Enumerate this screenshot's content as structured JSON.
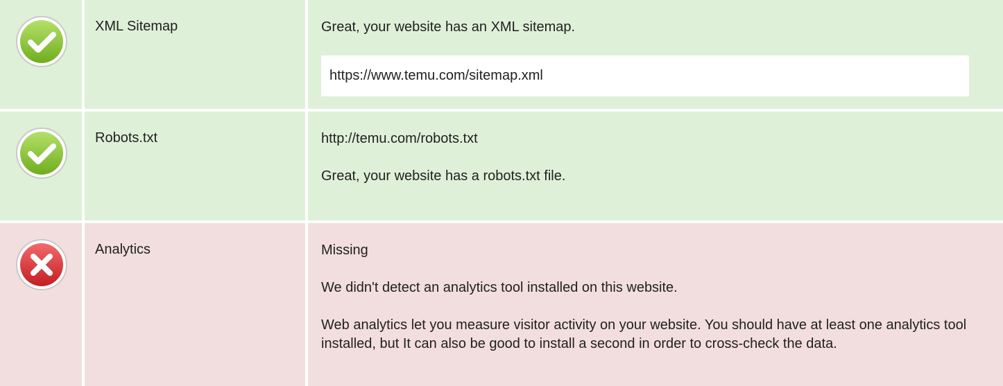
{
  "checks": [
    {
      "status": "pass",
      "status_icon": "check-circle-icon",
      "name": "XML Sitemap",
      "message": "Great, your website has an XML sitemap.",
      "url": "https://www.temu.com/sitemap.xml"
    },
    {
      "status": "pass",
      "status_icon": "check-circle-icon",
      "name": "Robots.txt",
      "url": "http://temu.com/robots.txt",
      "message": "Great, your website has a robots.txt file."
    },
    {
      "status": "fail",
      "status_icon": "cross-circle-icon",
      "name": "Analytics",
      "result": "Missing",
      "message": "We didn't detect an analytics tool installed on this website.",
      "advice": "Web analytics let you measure visitor activity on your website. You should have at least one analytics tool installed, but It can also be good to install a second in order to cross-check the data."
    }
  ],
  "colors": {
    "pass_background": "#dff0d8",
    "fail_background": "#f2dede",
    "pass_icon": "#8dc63f",
    "fail_icon": "#d9383a"
  }
}
